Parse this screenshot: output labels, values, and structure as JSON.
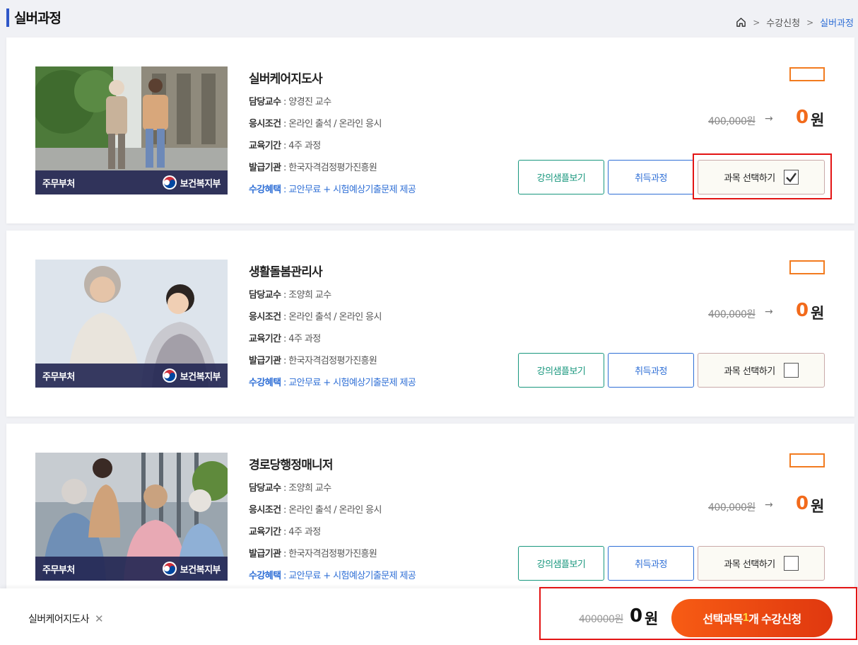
{
  "page": {
    "title": "실버과정"
  },
  "breadcrumb": {
    "home_icon": "home-icon",
    "items": [
      "수강신청",
      "실버과정"
    ]
  },
  "labels": {
    "professor": "담당교수",
    "exam": "응시조건",
    "period": "교육기간",
    "issuer": "발급기관",
    "benefit": "수강혜택",
    "sample_btn": "강의샘플보기",
    "acquire_btn": "취득과정",
    "select_btn": "과목 선택하기",
    "won": "원",
    "band_left": "주무부처",
    "band_right": "보건복지부"
  },
  "courses": [
    {
      "title": "실버케어지도사",
      "professor": ": 양경진 교수",
      "exam": ": 온라인 출석 / 온라인 응시",
      "period": ": 4주 과정",
      "issuer": ": 한국자격검정평가진흥원",
      "benefit": ": 교안무료 + 시험예상기출문제 제공",
      "original_price": "400,000원",
      "price": "0",
      "selected": true
    },
    {
      "title": "생활돌봄관리사",
      "professor": ": 조양희 교수",
      "exam": ": 온라인 출석 / 온라인 응시",
      "period": ": 4주 과정",
      "issuer": ": 한국자격검정평가진흥원",
      "benefit": ": 교안무료 + 시험예상기출문제 제공",
      "original_price": "400,000원",
      "price": "0",
      "selected": false
    },
    {
      "title": "경로당행정매니저",
      "professor": ": 조양희 교수",
      "exam": ": 온라인 출석 / 온라인 응시",
      "period": ": 4주 과정",
      "issuer": ": 한국자격검정평가진흥원",
      "benefit": ": 교안무료 + 시험예상기출문제 제공",
      "original_price": "400,000원",
      "price": "0",
      "selected": false
    }
  ],
  "cart": {
    "selected_item": "실버케어지도사",
    "remove": "✕",
    "original_total": "400000원",
    "total": "0",
    "won": "원",
    "apply_prefix": "선택과목 ",
    "apply_count": "1",
    "apply_suffix": "개 수강신청"
  },
  "colors": {
    "accent": "#f26a1b",
    "blue": "#2f6fd6",
    "green": "#19977e",
    "highlight": "#e31414"
  }
}
